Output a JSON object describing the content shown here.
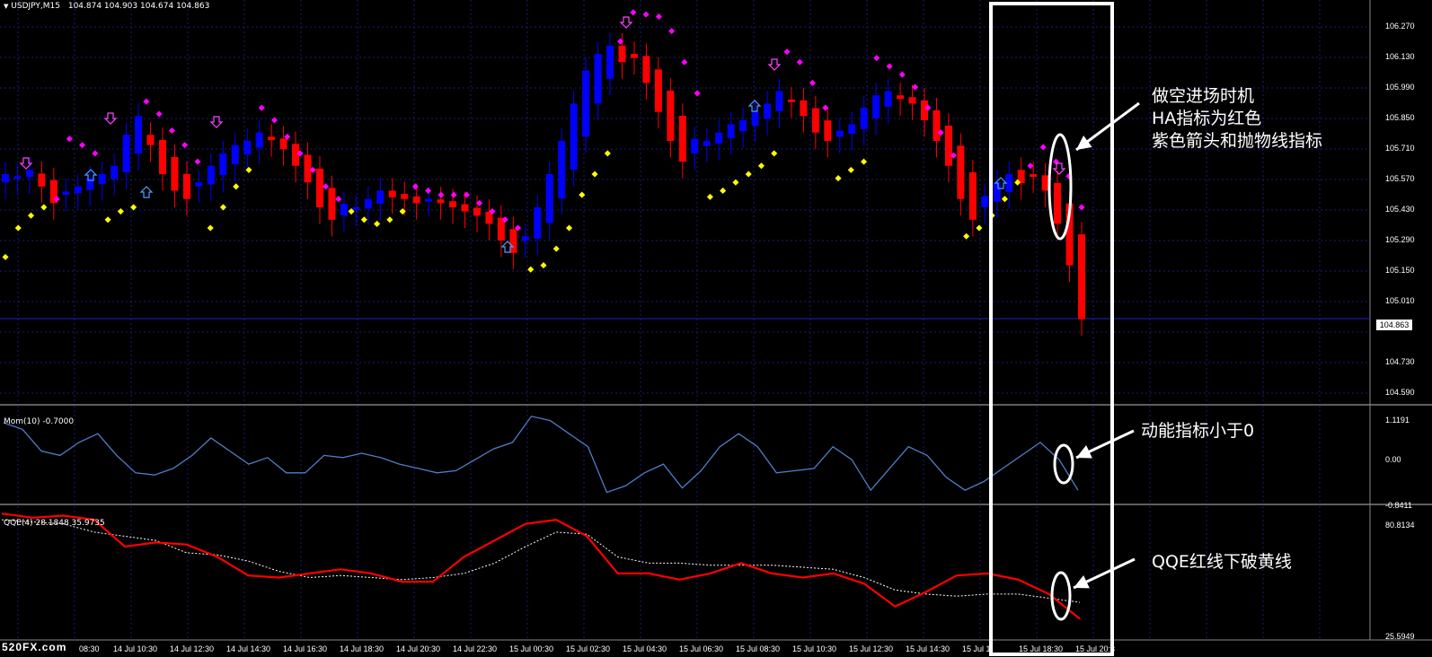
{
  "chart_window": {
    "title": "USDJPY,M15",
    "ohlc": "104.874 104.903 104.674 104.863",
    "current_price": "104.863"
  },
  "price_axis": [
    "106.270",
    "106.130",
    "105.990",
    "105.850",
    "105.710",
    "105.570",
    "105.430",
    "105.290",
    "105.150",
    "105.010",
    "104.730",
    "104.590"
  ],
  "mom_panel": {
    "label": "Mom(10) -0.7000",
    "axis": [
      "1.1191",
      "0.00",
      "-0.8411"
    ]
  },
  "qqe_panel": {
    "label": "QQE(4) 28.1848 35.9735",
    "axis": [
      "80.8134",
      "25.5949"
    ]
  },
  "time_axis": [
    "08:30",
    "14 Jul 10:30",
    "14 Jul 12:30",
    "14 Jul 14:30",
    "14 Jul 16:30",
    "14 Jul 18:30",
    "14 Jul 20:30",
    "14 Jul 22:30",
    "15 Jul 00:30",
    "15 Jul 02:30",
    "15 Jul 04:30",
    "15 Jul 06:30",
    "15 Jul 08:30",
    "15 Jul 10:30",
    "15 Jul 12:30",
    "15 Jul 14:30",
    "15 Jul 1",
    "15 Jul 18:30",
    "15 Jul 20:3"
  ],
  "watermark": "520FX.com",
  "annotations": {
    "entry": [
      "做空进场时机",
      "HA指标为红色",
      "紫色箭头和抛物线指标"
    ],
    "momentum": "动能指标小于0",
    "qqe": "QQE红线下破黄线"
  },
  "colors": {
    "bull": "#0000ff",
    "bear": "#ff0000",
    "sar_up": "#ffff00",
    "sar_down": "#ff00ff",
    "mom_line": "#4f7ec8",
    "qqe_fast": "#ff0000",
    "qqe_slow": "#ffffff",
    "grid": "#1a1a7a"
  },
  "chart_data": [
    {
      "type": "candlestick",
      "title": "USDJPY,M15",
      "ylim": [
        104.59,
        106.27
      ],
      "ha_close_series": [
        105.52,
        105.55,
        105.58,
        105.5,
        105.42,
        105.46,
        105.5,
        105.54,
        105.56,
        105.6,
        105.75,
        105.84,
        105.7,
        105.56,
        105.48,
        105.44,
        105.52,
        105.6,
        105.66,
        105.7,
        105.72,
        105.76,
        105.74,
        105.68,
        105.6,
        105.52,
        105.4,
        105.34,
        105.36,
        105.4,
        105.44,
        105.48,
        105.48,
        105.44,
        105.42,
        105.44,
        105.42,
        105.4,
        105.38,
        105.36,
        105.32,
        105.24,
        105.18,
        105.26,
        105.4,
        105.56,
        105.72,
        105.9,
        106.06,
        106.14,
        106.18,
        106.18,
        106.12,
        106.0,
        105.86,
        105.72,
        105.62,
        105.66,
        105.72,
        105.76,
        105.8,
        105.82,
        105.86,
        105.9,
        105.96,
        105.92,
        105.84,
        105.76,
        105.72,
        105.74,
        105.8,
        105.88,
        105.94,
        105.96,
        105.94,
        105.9,
        105.82,
        105.72,
        105.6,
        105.44,
        105.34,
        105.4,
        105.52,
        105.56,
        105.58,
        105.56,
        105.48,
        105.32,
        105.12,
        104.86
      ],
      "ha_color_series": [
        "bull",
        "bull",
        "bull",
        "bear",
        "bear",
        "bull",
        "bull",
        "bull",
        "bull",
        "bull",
        "bull",
        "bull",
        "bear",
        "bear",
        "bear",
        "bear",
        "bull",
        "bull",
        "bull",
        "bull",
        "bull",
        "bull",
        "bear",
        "bear",
        "bear",
        "bear",
        "bear",
        "bear",
        "bull",
        "bull",
        "bull",
        "bull",
        "bear",
        "bear",
        "bear",
        "bull",
        "bear",
        "bear",
        "bear",
        "bear",
        "bear",
        "bear",
        "bear",
        "bull",
        "bull",
        "bull",
        "bull",
        "bull",
        "bull",
        "bull",
        "bull",
        "bear",
        "bear",
        "bear",
        "bear",
        "bear",
        "bear",
        "bull",
        "bull",
        "bull",
        "bull",
        "bull",
        "bull",
        "bull",
        "bull",
        "bear",
        "bear",
        "bear",
        "bear",
        "bull",
        "bull",
        "bull",
        "bull",
        "bull",
        "bear",
        "bear",
        "bear",
        "bear",
        "bear",
        "bear",
        "bear",
        "bull",
        "bull",
        "bull",
        "bear",
        "bear",
        "bear",
        "bear",
        "bear",
        "bear"
      ],
      "sar_series": [
        105.16,
        105.3,
        105.36,
        105.4,
        105.44,
        105.73,
        105.7,
        105.66,
        105.34,
        105.38,
        105.4,
        105.91,
        105.85,
        105.77,
        105.7,
        105.62,
        105.3,
        105.4,
        105.5,
        105.58,
        105.88,
        105.82,
        105.74,
        105.66,
        105.58,
        105.5,
        105.44,
        105.38,
        105.34,
        105.32,
        105.34,
        105.38,
        105.5,
        105.48,
        105.46,
        105.46,
        105.46,
        105.42,
        105.38,
        105.34,
        105.3,
        105.1,
        105.12,
        105.2,
        105.3,
        105.46,
        105.56,
        105.66,
        106.2,
        106.34,
        106.33,
        106.32,
        106.25,
        106.1,
        105.95,
        105.45,
        105.48,
        105.52,
        105.56,
        105.6,
        105.66,
        106.15,
        106.1,
        106.0,
        105.88,
        105.54,
        105.58,
        105.62,
        106.12,
        106.08,
        106.04,
        105.98,
        105.88,
        105.76,
        105.65,
        105.26,
        105.3,
        105.36,
        105.44,
        105.52,
        105.6,
        105.69,
        105.62,
        105.55,
        105.4
      ]
    },
    {
      "type": "line",
      "title": "Mom(10) -0.7000",
      "ylim": [
        -0.8411,
        1.1191
      ],
      "series": [
        {
          "name": "Mom(10)",
          "values": [
            0.85,
            0.7,
            0.2,
            0.1,
            0.4,
            0.6,
            0.1,
            -0.3,
            -0.35,
            -0.2,
            0.1,
            0.5,
            0.2,
            -0.1,
            0.05,
            -0.3,
            -0.3,
            0.1,
            0.05,
            0.15,
            0.05,
            -0.1,
            -0.2,
            -0.3,
            -0.25,
            0.0,
            0.25,
            0.4,
            1.0,
            0.9,
            0.6,
            0.3,
            -0.75,
            -0.6,
            -0.3,
            -0.1,
            -0.65,
            -0.25,
            0.3,
            0.6,
            0.3,
            -0.3,
            -0.25,
            -0.2,
            0.3,
            0.0,
            -0.7,
            -0.2,
            0.3,
            0.1,
            -0.4,
            -0.7,
            -0.5,
            -0.2,
            0.1,
            0.4,
            0.0,
            -0.7
          ]
        }
      ]
    },
    {
      "type": "line",
      "title": "QQE(4) 28.1848 35.9735",
      "ylim": [
        25.5949,
        80.8134
      ],
      "series": [
        {
          "name": "28.1848",
          "values": [
            79,
            77,
            78,
            76,
            63,
            65,
            64,
            58,
            49,
            48,
            50,
            52,
            50,
            46,
            46,
            58,
            66,
            74,
            76,
            68,
            50,
            50,
            47,
            50,
            55,
            50,
            48,
            50,
            45,
            34,
            41,
            49,
            50,
            47,
            40,
            28
          ]
        },
        {
          "name": "35.9735",
          "values": [
            76,
            75,
            74,
            70,
            68,
            66,
            60,
            59,
            56,
            51,
            48,
            49,
            48,
            47,
            48,
            50,
            55,
            63,
            70,
            69,
            58,
            55,
            55,
            54,
            54,
            54,
            53,
            52,
            48,
            42,
            40,
            39,
            40,
            40,
            38,
            36
          ]
        }
      ]
    }
  ]
}
